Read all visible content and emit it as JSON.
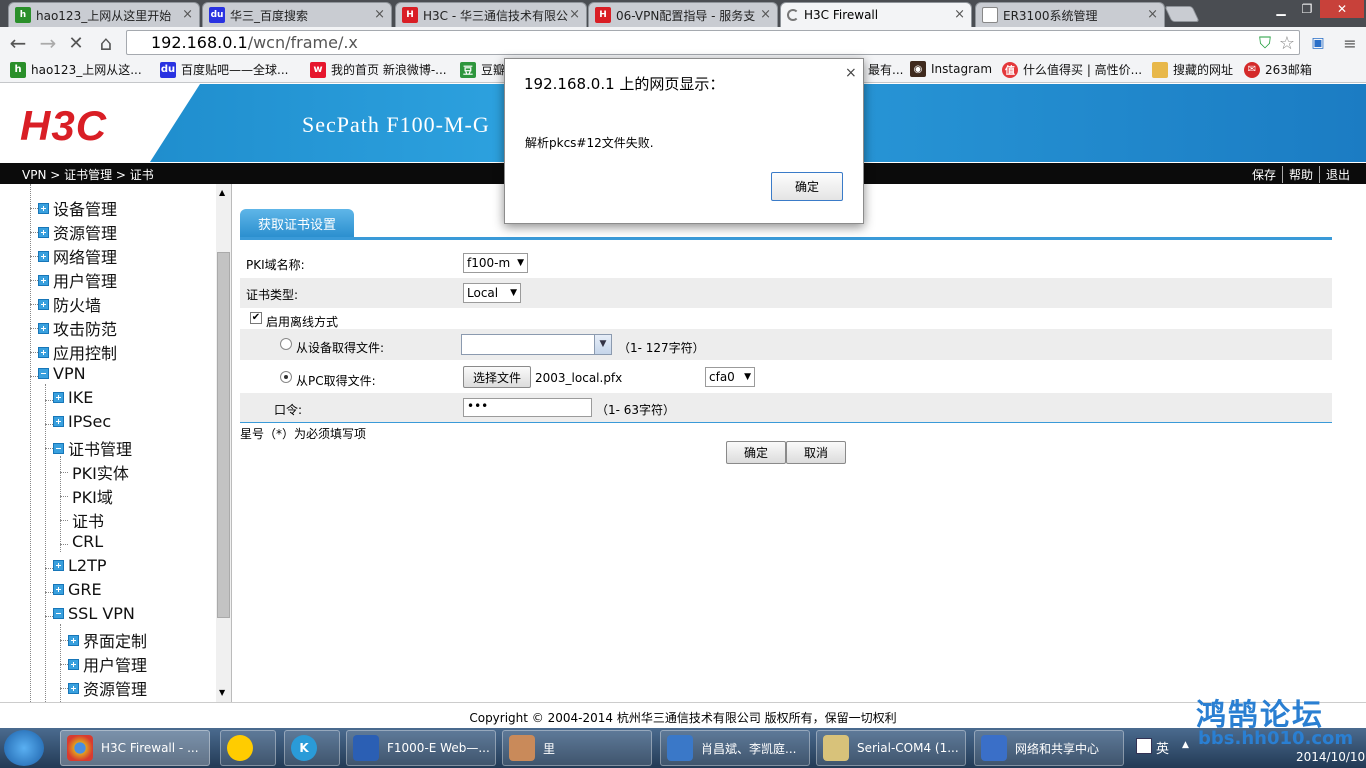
{
  "browser": {
    "tabs": [
      {
        "title": "hao123_上网从这里开始",
        "icon": "hao123-icon",
        "color": "#2a8f2a",
        "active": false
      },
      {
        "title": "华三_百度搜索",
        "icon": "baidu-icon",
        "color": "#2932e1",
        "active": false
      },
      {
        "title": "H3C - 华三通信技术有限公",
        "icon": "h3c-icon",
        "color": "#d91e25",
        "active": false
      },
      {
        "title": "06-VPN配置指导 - 服务支",
        "icon": "h3c-icon",
        "color": "#d91e25",
        "active": false
      },
      {
        "title": "H3C Firewall",
        "icon": "loading-icon",
        "color": "#666666",
        "active": true
      },
      {
        "title": "ER3100系统管理",
        "icon": "page-icon",
        "color": "#888888",
        "active": false
      }
    ],
    "url_host": "192.168.0.1",
    "url_path": "/wcn/frame/.x",
    "bookmarks": [
      {
        "label": "hao123_上网从这...",
        "icon": "hao123-icon",
        "color": "#2a8f2a"
      },
      {
        "label": "百度贴吧——全球...",
        "icon": "baidu-icon",
        "color": "#2932e1"
      },
      {
        "label": "我的首页 新浪微博-...",
        "icon": "weibo-icon",
        "color": "#e6162d"
      },
      {
        "label": "豆瓣",
        "icon": "douban-icon",
        "color": "#2e963d"
      },
      {
        "label": "最有...",
        "icon": "page-icon",
        "color": "#888888"
      },
      {
        "label": "Instagram",
        "icon": "instagram-icon",
        "color": "#3f2a1e"
      },
      {
        "label": "什么值得买 | 高性价...",
        "icon": "smzdm-icon",
        "color": "#e4393c"
      },
      {
        "label": "搜藏的网址",
        "icon": "folder-icon",
        "color": "#e8b84a"
      },
      {
        "label": "263邮箱",
        "icon": "mail263-icon",
        "color": "#d42a2a"
      }
    ]
  },
  "app": {
    "logo": "H3C",
    "product": "SecPath F100-M-G",
    "breadcrumb": "VPN > 证书管理 > 证书",
    "header_links": [
      "保存",
      "帮助",
      "退出"
    ]
  },
  "sidebar": {
    "items": [
      {
        "label": "设备管理",
        "level": 1,
        "type": "plus"
      },
      {
        "label": "资源管理",
        "level": 1,
        "type": "plus"
      },
      {
        "label": "网络管理",
        "level": 1,
        "type": "plus"
      },
      {
        "label": "用户管理",
        "level": 1,
        "type": "plus"
      },
      {
        "label": "防火墙",
        "level": 1,
        "type": "plus"
      },
      {
        "label": "攻击防范",
        "level": 1,
        "type": "plus"
      },
      {
        "label": "应用控制",
        "level": 1,
        "type": "plus"
      },
      {
        "label": "VPN",
        "level": 1,
        "type": "minus"
      },
      {
        "label": "IKE",
        "level": 2,
        "type": "plus"
      },
      {
        "label": "IPSec",
        "level": 2,
        "type": "plus"
      },
      {
        "label": "证书管理",
        "level": 2,
        "type": "minus"
      },
      {
        "label": "PKI实体",
        "level": 3,
        "type": "leaf"
      },
      {
        "label": "PKI域",
        "level": 3,
        "type": "leaf"
      },
      {
        "label": "证书",
        "level": 3,
        "type": "leaf"
      },
      {
        "label": "CRL",
        "level": 3,
        "type": "leaf"
      },
      {
        "label": "L2TP",
        "level": 2,
        "type": "plus"
      },
      {
        "label": "GRE",
        "level": 2,
        "type": "plus"
      },
      {
        "label": "SSL VPN",
        "level": 2,
        "type": "minus"
      },
      {
        "label": "界面定制",
        "level": 3,
        "type": "plus"
      },
      {
        "label": "用户管理",
        "level": 3,
        "type": "plus"
      },
      {
        "label": "资源管理",
        "level": 3,
        "type": "plus"
      }
    ]
  },
  "form": {
    "tab_label": "获取证书设置",
    "pki_domain_label": "PKI域名称:",
    "pki_domain_value": "f100-m",
    "cert_type_label": "证书类型:",
    "cert_type_value": "Local",
    "offline_label": "启用离线方式",
    "from_device_label": "从设备取得文件:",
    "from_device_hint": "（1- 127字符）",
    "from_pc_label": "从PC取得文件:",
    "choose_file_label": "选择文件",
    "chosen_file": "2003_local.pfx",
    "storage_value": "cfa0",
    "password_label": "口令:",
    "password_value": "•••",
    "password_hint": "（1- 63字符）",
    "required_note": "星号（*）为必须填写项",
    "ok_label": "确定",
    "cancel_label": "取消"
  },
  "footer": {
    "copyright": "Copyright © 2004-2014 杭州华三通信技术有限公司 版权所有，保留一切权利",
    "watermark": "鸿鹄论坛",
    "watermark_url": "bbs.hh010.com"
  },
  "dialog": {
    "title": "192.168.0.1 上的网页显示：",
    "message": "解析pkcs#12文件失败.",
    "ok_label": "确定"
  },
  "taskbar": {
    "items": [
      {
        "label": "H3C Firewall - ...",
        "icon": "chrome-icon",
        "color": "#e0a020"
      },
      {
        "label": "",
        "icon": "qq-icon",
        "color": "#ffcc00"
      },
      {
        "label": "",
        "icon": "k-icon",
        "color": "#2a9bd8"
      },
      {
        "label": "F1000-E Web—...",
        "icon": "word-icon",
        "color": "#2b5fb4"
      },
      {
        "label": "里",
        "icon": "avatar-icon",
        "color": "#c98a5a"
      },
      {
        "label": "肖昌斌、李凯庭...",
        "icon": "chat-icon",
        "color": "#3a78c8"
      },
      {
        "label": "Serial-COM4 (1...",
        "icon": "terminal-icon",
        "color": "#d8c27a"
      },
      {
        "label": "网络和共享中心",
        "icon": "network-icon",
        "color": "#3a6fc8"
      }
    ],
    "ime": "英",
    "date": "2014/10/10"
  }
}
